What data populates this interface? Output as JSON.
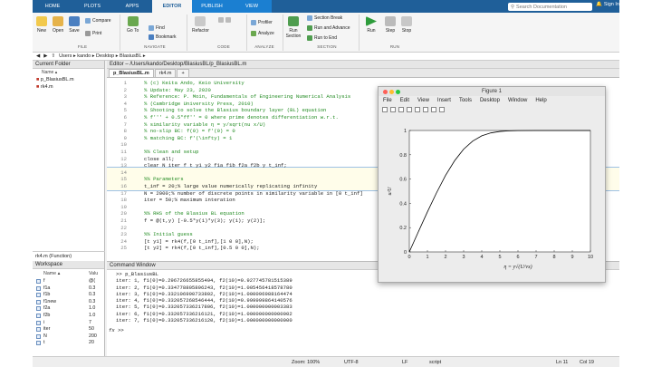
{
  "tabs": [
    "HOME",
    "PLOTS",
    "APPS",
    "EDITOR",
    "PUBLISH",
    "VIEW"
  ],
  "search": {
    "placeholder": "Search Documentation"
  },
  "signin": "Sign In",
  "ribbon": {
    "new": "New",
    "open": "Open",
    "save": "Save",
    "compare": "Compare",
    "goto": "Go To",
    "find": "Find",
    "print": "Print",
    "bookmark": "Bookmark",
    "refactor": "Refactor",
    "profiler": "Profiler",
    "analyze": "Analyze",
    "run_section": "Run Section",
    "section_break": "Section Break",
    "run_advance": "Run and Advance",
    "run_end": "Run to End",
    "run": "Run",
    "step": "Step",
    "stop": "Stop",
    "groups": [
      "FILE",
      "NAVIGATE",
      "CODE",
      "ANALYZE",
      "SECTION",
      "RUN"
    ]
  },
  "path": "Users ▸ kando ▸ Desktop ▸ BlasiusBL ▸",
  "current_folder": {
    "title": "Current Folder",
    "header": "Name ▴",
    "files": [
      "p_BlasiusBL.m",
      "rk4.m"
    ],
    "detail": "rk4.m (Function)"
  },
  "editor": {
    "title": "Editor – /Users/kando/Desktop/BlasiusBL/p_BlasiusBL.m",
    "tabs": [
      "p_BlasiusBL.m",
      "rk4.m",
      "+"
    ],
    "lines": [
      {
        "n": "1",
        "t": "% (c) Keita Ando, Keio University",
        "c": "cmt"
      },
      {
        "n": "2",
        "t": "% Update: May 23, 2020",
        "c": "cmt"
      },
      {
        "n": "3",
        "t": "% Reference: P. Moin, Fundamentals of Engineering Numerical Analysis",
        "c": "cmt"
      },
      {
        "n": "4",
        "t": "% (Cambridge University Press, 2010)",
        "c": "cmt"
      },
      {
        "n": "5",
        "t": "% Shooting to solve the Blasius boundary layer (BL) equation",
        "c": "cmt"
      },
      {
        "n": "6",
        "t": "% f''' + 0.5*ff'' = 0 where prime denotes differentiation w.r.t.",
        "c": "cmt"
      },
      {
        "n": "7",
        "t": "% similarity variable η = y/sqrt(nu x/U)",
        "c": "cmt"
      },
      {
        "n": "8",
        "t": "% no-slip BC: f(0) = f'(0) = 0",
        "c": "cmt"
      },
      {
        "n": "9",
        "t": "% matching BC: f'(\\infty) = 1",
        "c": "cmt"
      },
      {
        "n": "10",
        "t": "",
        "c": ""
      },
      {
        "n": "11",
        "t": "%% Clean and setup",
        "c": "cmt"
      },
      {
        "n": "12",
        "t": "close all;",
        "c": ""
      },
      {
        "n": "13",
        "t": "clear N iter f t y1 y2 f1a f1b f2a f2b y t_inf;",
        "c": ""
      },
      {
        "n": "14",
        "t": "",
        "c": ""
      },
      {
        "n": "15",
        "t": "%% Parameters",
        "c": "cmt"
      },
      {
        "n": "16",
        "t": "t_inf = 20;% large value numerically replicating infinity",
        "c": ""
      },
      {
        "n": "17",
        "t": "N = 2000;% number of discrete points in similarity variable in [0 t_inf]",
        "c": ""
      },
      {
        "n": "18",
        "t": "iter = 50;% maximum interation",
        "c": ""
      },
      {
        "n": "19",
        "t": "",
        "c": ""
      },
      {
        "n": "20",
        "t": "%% RHS of the Blasius BL equation",
        "c": "cmt"
      },
      {
        "n": "21",
        "t": "f = @(t,y) [-0.5*y(1)*y(3); y(1); y(2)];",
        "c": ""
      },
      {
        "n": "22",
        "t": "",
        "c": ""
      },
      {
        "n": "23",
        "t": "%% Initial guess",
        "c": "cmt"
      },
      {
        "n": "24",
        "t": "[t y1] = rk4(f,[0 t_inf],[1 0 0],N);",
        "c": ""
      },
      {
        "n": "25",
        "t": "[t y2] = rk4(f,[0 t_inf],[0.5 0 0],N);",
        "c": ""
      }
    ]
  },
  "workspace": {
    "title": "Workspace",
    "col_name": "Name ▴",
    "col_val": "Valu",
    "vars": [
      {
        "n": "f",
        "v": "@("
      },
      {
        "n": "f1a",
        "v": "0.3"
      },
      {
        "n": "f1b",
        "v": "0.3"
      },
      {
        "n": "f1new",
        "v": "0.3"
      },
      {
        "n": "f2a",
        "v": "1.0"
      },
      {
        "n": "f2b",
        "v": "1.0"
      },
      {
        "n": "i",
        "v": "7"
      },
      {
        "n": "iter",
        "v": "50"
      },
      {
        "n": "N",
        "v": "200"
      },
      {
        "n": "t",
        "v": "20"
      }
    ]
  },
  "command": {
    "title": "Command Window",
    "lines": [
      ">> p_BlasiusBL",
      "iter: 1, f1(0)=0.296726655855494, f2(10)=0.927745781515389",
      "iter: 2, f1(0)=0.334778805896243, f2(10)=1.005456418578780",
      "iter: 3, f1(0)=0.332106990733802, f2(10)=1.000096988164474",
      "iter: 4, f1(0)=0.332057268546444, f2(10)=0.999999864140576",
      "iter: 5, f1(0)=0.332057336217806, f2(10)=1.000000000003383",
      "iter: 6, f1(0)=0.332057336216121, f2(10)=1.000000000000002",
      "iter: 7, f1(0)=0.332057336216120, f2(10)=1.000000000000000"
    ],
    "prompt": ">>"
  },
  "statusbar": {
    "zoom": "Zoom: 100%",
    "encoding": "UTF-8",
    "eol": "LF",
    "type": "script",
    "ln": "Ln  11",
    "col": "Col  19"
  },
  "figure": {
    "title": "Figure 1",
    "menu": [
      "File",
      "Edit",
      "View",
      "Insert",
      "Tools",
      "Desktop",
      "Window",
      "Help"
    ],
    "chart_data": {
      "type": "line",
      "xlim": [
        0,
        10
      ],
      "ylim": [
        0,
        1
      ],
      "xticks": [
        "0",
        "1",
        "2",
        "3",
        "4",
        "5",
        "6",
        "7",
        "8",
        "9",
        "10"
      ],
      "yticks": [
        "0",
        "0.2",
        "0.4",
        "0.6",
        "0.8",
        "1"
      ],
      "ylabel": "u/U",
      "xlabel": "η = y√(U/νx)",
      "x": [
        0,
        0.5,
        1,
        1.5,
        2,
        2.5,
        3,
        3.5,
        4,
        4.5,
        5,
        5.5,
        6,
        7,
        8,
        9,
        10
      ],
      "y": [
        0,
        0.166,
        0.33,
        0.486,
        0.63,
        0.751,
        0.846,
        0.913,
        0.956,
        0.98,
        0.992,
        0.997,
        0.999,
        1,
        1,
        1,
        1
      ]
    }
  }
}
